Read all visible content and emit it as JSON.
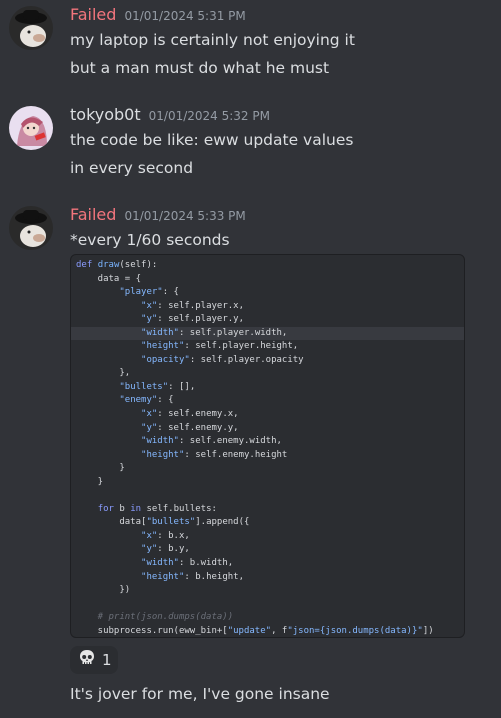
{
  "messages": [
    {
      "author": "Failed",
      "author_color": "#f2757d",
      "timestamp": "01/01/2024 5:31 PM",
      "lines": [
        "my laptop is certainly not enjoying it",
        "but a man must do what he must"
      ]
    },
    {
      "author": "tokyob0t",
      "author_color": "#dbdee1",
      "timestamp": "01/01/2024 5:32 PM",
      "lines": [
        "the code be like: eww update values",
        "in every second"
      ]
    },
    {
      "author": "Failed",
      "author_color": "#f2757d",
      "timestamp": "01/01/2024 5:33 PM",
      "lines": [
        "*every 1/60 seconds"
      ],
      "code": [
        "def draw(self):",
        "    data = {",
        "        \"player\": {",
        "            \"x\": self.player.x,",
        "            \"y\": self.player.y,",
        "            \"width\": self.player.width,",
        "            \"height\": self.player.height,",
        "            \"opacity\": self.player.opacity",
        "        },",
        "        \"bullets\": [],",
        "        \"enemy\": {",
        "            \"x\": self.enemy.x,",
        "            \"y\": self.enemy.y,",
        "            \"width\": self.enemy.width,",
        "            \"height\": self.enemy.height",
        "        }",
        "    }",
        "",
        "    for b in self.bullets:",
        "        data[\"bullets\"].append({",
        "            \"x\": b.x,",
        "            \"y\": b.y,",
        "            \"width\": b.width,",
        "            \"height\": b.height,",
        "        })",
        "",
        "    # print(json.dumps(data))",
        "    subprocess.run(eww_bin+[\"update\", f\"json={json.dumps(data)}\"])"
      ],
      "reaction": {
        "emoji": "skull-emoji",
        "count": "1"
      },
      "followup": "It's jover for me, I've gone insane"
    }
  ]
}
